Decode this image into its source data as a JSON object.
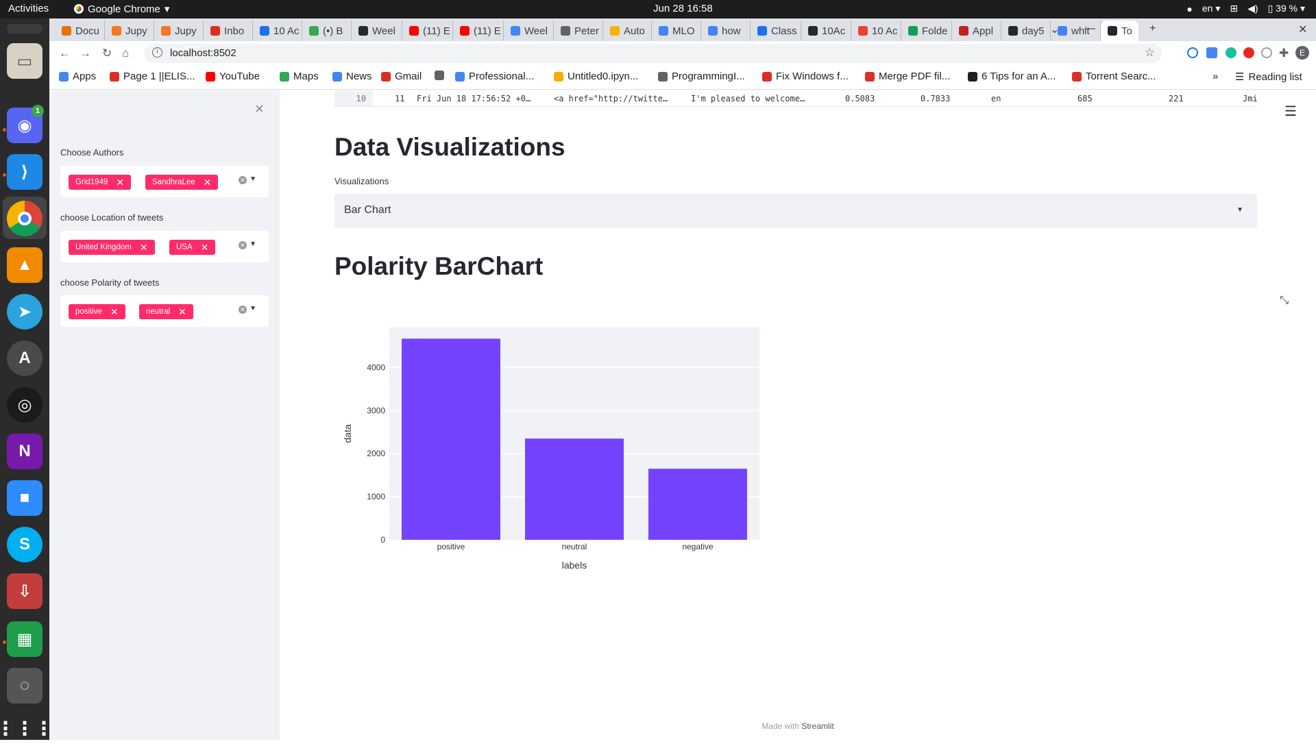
{
  "system": {
    "activities": "Activities",
    "app_name": "Google Chrome",
    "clock": "Jun 28  16:58",
    "language": "en",
    "battery": "39 %"
  },
  "browser": {
    "tabs": [
      {
        "label": "Docu",
        "color": "#e8710a"
      },
      {
        "label": "Jupy",
        "color": "#f37626"
      },
      {
        "label": "Jupy",
        "color": "#f37626"
      },
      {
        "label": "Inbo",
        "color": "#d93025"
      },
      {
        "label": "10 Ac",
        "color": "#1a73e8"
      },
      {
        "label": "(•) B",
        "color": "#34a853"
      },
      {
        "label": "Weel",
        "color": "#24292f"
      },
      {
        "label": "(11) E",
        "color": "#ff0000"
      },
      {
        "label": "(11) E",
        "color": "#ff0000"
      },
      {
        "label": "Weel",
        "color": "#4285f4"
      },
      {
        "label": "Peter",
        "color": "#5f6368"
      },
      {
        "label": "Auto",
        "color": "#f4b400"
      },
      {
        "label": "MLO",
        "color": "#4285f4"
      },
      {
        "label": "how",
        "color": "#4285f4"
      },
      {
        "label": "Class",
        "color": "#1a73e8"
      },
      {
        "label": "10Ac",
        "color": "#24292f"
      },
      {
        "label": "10 Ac",
        "color": "#ea4335"
      },
      {
        "label": "Folde",
        "color": "#0f9d58"
      },
      {
        "label": "Appl",
        "color": "#c5221f"
      },
      {
        "label": "day5",
        "color": "#24292f"
      },
      {
        "label": "whit",
        "color": "#4285f4"
      },
      {
        "label": "To",
        "color": "#24292f"
      }
    ],
    "url": "localhost:8502",
    "bookmarks": [
      {
        "label": "Apps",
        "color": "#4285f4"
      },
      {
        "label": "Page 1 ||ELIS...",
        "color": "#d93025"
      },
      {
        "label": "YouTube",
        "color": "#ff0000"
      },
      {
        "label": "Maps",
        "color": "#34a853"
      },
      {
        "label": "News",
        "color": "#4285f4"
      },
      {
        "label": "Gmail",
        "color": "#d93025"
      },
      {
        "label": "",
        "color": "#5f6368"
      },
      {
        "label": "Professional...",
        "color": "#4285f4"
      },
      {
        "label": "Untitled0.ipyn...",
        "color": "#f9ab00"
      },
      {
        "label": "ProgrammingI...",
        "color": "#5f6368"
      },
      {
        "label": "Fix Windows f...",
        "color": "#d93025"
      },
      {
        "label": "Merge PDF fil...",
        "color": "#d93025"
      },
      {
        "label": "6 Tips for an A...",
        "color": "#202124"
      },
      {
        "label": "Torrent Searc...",
        "color": "#d93025"
      }
    ],
    "reading_list": "Reading list",
    "more": "»",
    "profile": "E"
  },
  "sidebar": {
    "close": "×",
    "filters": [
      {
        "label": "Choose Authors",
        "chips": [
          "Grid1949",
          "SandhraLee"
        ]
      },
      {
        "label": "choose Location of tweets",
        "chips": [
          "United Kingdom",
          "USA"
        ]
      },
      {
        "label": "choose Polarity of tweets",
        "chips": [
          "positive",
          "neutral"
        ]
      }
    ]
  },
  "table_row": {
    "index": "10",
    "cells": [
      "11",
      "Fri Jun 18 17:56:52 +0…",
      "<a href=\"http://twitte…",
      "I'm pleased to welcome…",
      "0.5083",
      "0.7833",
      "en",
      "685",
      "221",
      "Jmi"
    ]
  },
  "main": {
    "section_title": "Data Visualizations",
    "select_label": "Visualizations",
    "select_value": "Bar Chart",
    "chart_title": "Polarity BarChart",
    "footer_prefix": "Made with ",
    "footer_brand": "Streamlit"
  },
  "chart_data": {
    "type": "bar",
    "categories": [
      "positive",
      "neutral",
      "negative"
    ],
    "values": [
      4670,
      2350,
      1650
    ],
    "xlabel": "labels",
    "ylabel": "data",
    "ylim": [
      0,
      4930
    ],
    "yticks": [
      0,
      1000,
      2000,
      3000,
      4000
    ],
    "grid": true,
    "colors": {
      "bar": "#7443ff",
      "plot_bg": "#f0f2f6"
    }
  }
}
